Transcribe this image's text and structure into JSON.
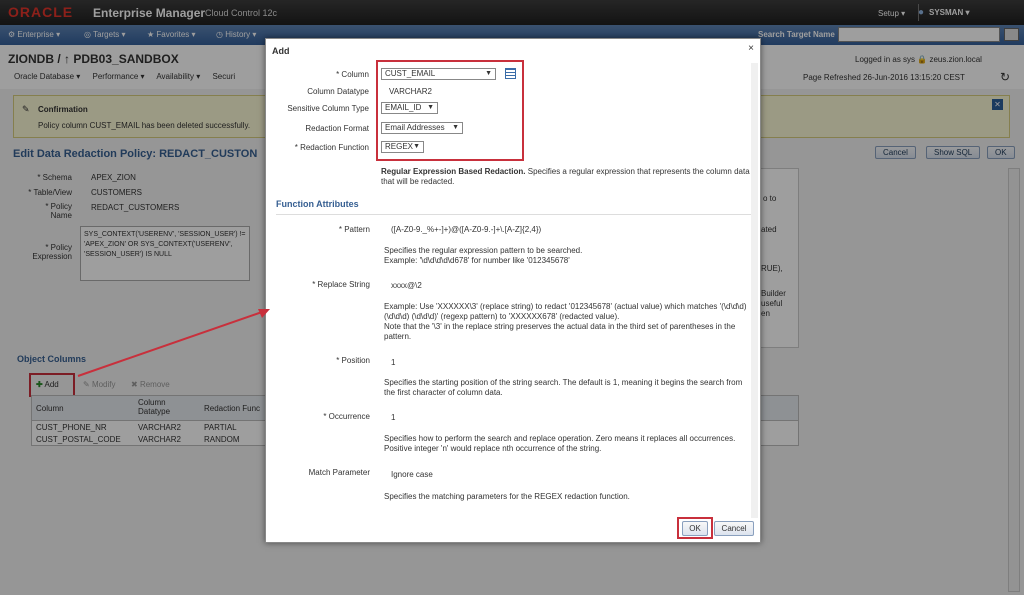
{
  "topbar": {
    "logo": "ORACLE",
    "product": "Enterprise Manager",
    "edition": "Cloud Control 12c",
    "setup": "Setup ▾",
    "user": "SYSMAN ▾"
  },
  "menu": {
    "items": [
      "Enterprise ▾",
      "Targets ▾",
      "Favorites ▾",
      "History ▾"
    ],
    "search_label": "Search Target Name",
    "search_placeholder": ""
  },
  "context": {
    "target": "ZIONDB / ↑ PDB03_SANDBOX",
    "menu": [
      "Oracle Database ▾",
      "Performance ▾",
      "Availability ▾",
      "Securi"
    ],
    "logged_in": "Logged in as sys",
    "host": "zeus.zion.local",
    "refreshed": "Page Refreshed 26-Jun-2016 13:15:20 CEST"
  },
  "confirmation": {
    "title": "Confirmation",
    "message": "Policy column CUST_EMAIL has been deleted successfully."
  },
  "page": {
    "title": "Edit Data Redaction Policy: REDACT_CUSTON",
    "cancel": "Cancel",
    "show_sql": "Show SQL",
    "ok": "OK"
  },
  "form": {
    "schema_label": "* Schema",
    "schema": "APEX_ZION",
    "table_label": "* Table/View",
    "table": "CUSTOMERS",
    "policy_label": "* Policy\nName",
    "policy": "REDACT_CUSTOMERS",
    "expr_label": "* Policy\nExpression",
    "expr": "SYS_CONTEXT('USERENV', 'SESSION_USER') != 'APEX_ZION' OR SYS_CONTEXT('USERENV', 'SESSION_USER') IS NULL"
  },
  "objects": {
    "title": "Object Columns",
    "add": "Add",
    "modify": "Modify",
    "remove": "Remove",
    "headers": [
      "Column",
      "Column\nDatatype",
      "Redaction Func"
    ],
    "rows": [
      [
        "CUST_PHONE_NR",
        "VARCHAR2",
        "PARTIAL"
      ],
      [
        "CUST_POSTAL_CODE",
        "VARCHAR2",
        "RANDOM"
      ]
    ]
  },
  "side_snippets": [
    "o to",
    "ated",
    "RUE),",
    "Builder",
    "useful",
    "en"
  ],
  "dialog": {
    "title": "Add",
    "close": "×",
    "column_label": "* Column",
    "column": "CUST_EMAIL",
    "datatype_label": "Column Datatype",
    "datatype": "VARCHAR2",
    "sensitive_label": "Sensitive Column Type",
    "sensitive": "EMAIL_ID",
    "format_label": "Redaction Format",
    "format": "Email Addresses",
    "function_label": "* Redaction Function",
    "function": "REGEX",
    "function_desc_bold": "Regular Expression Based Redaction.",
    "function_desc": "Specifies a regular expression that represents the column data that will be redacted.",
    "section": "Function Attributes",
    "pattern_label": "* Pattern",
    "pattern": "([A-Z0-9._%+-]+)@([A-Z0-9.-]+\\.[A-Z]{2,4})",
    "pattern_help": "Specifies the regular expression pattern to be searched.\nExample: '\\d\\d\\d\\d\\d678' for number like '012345678'",
    "replace_label": "* Replace String",
    "replace": "xxxx@\\2",
    "replace_help": "Example: Use 'XXXXXX\\3' (replace string) to redact '012345678' (actual value) which matches '(\\d\\d\\d) (\\d\\d\\d) (\\d\\d\\d)' (regexp pattern) to 'XXXXXX678' (redacted value).\nNote that the '\\3' in the replace string preserves the actual data in the third set of parentheses in the pattern.",
    "position_label": "* Position",
    "position": "1",
    "position_help": "Specifies the starting position of the string search. The default is 1, meaning it begins the search from the first character of column data.",
    "occurrence_label": "* Occurrence",
    "occurrence": "1",
    "occurrence_help": "Specifies how to perform the search and replace operation. Zero means it replaces all occurrences. Positive integer 'n' would replace nth occurrence of the string.",
    "match_label": "Match Parameter",
    "match": "Ignore case",
    "match_help": "Specifies the matching parameters for the REGEX redaction function.",
    "ok": "OK",
    "cancel": "Cancel"
  },
  "colors": {
    "accent": "#c8303c",
    "brand": "#e3342a",
    "link": "#365f92"
  }
}
